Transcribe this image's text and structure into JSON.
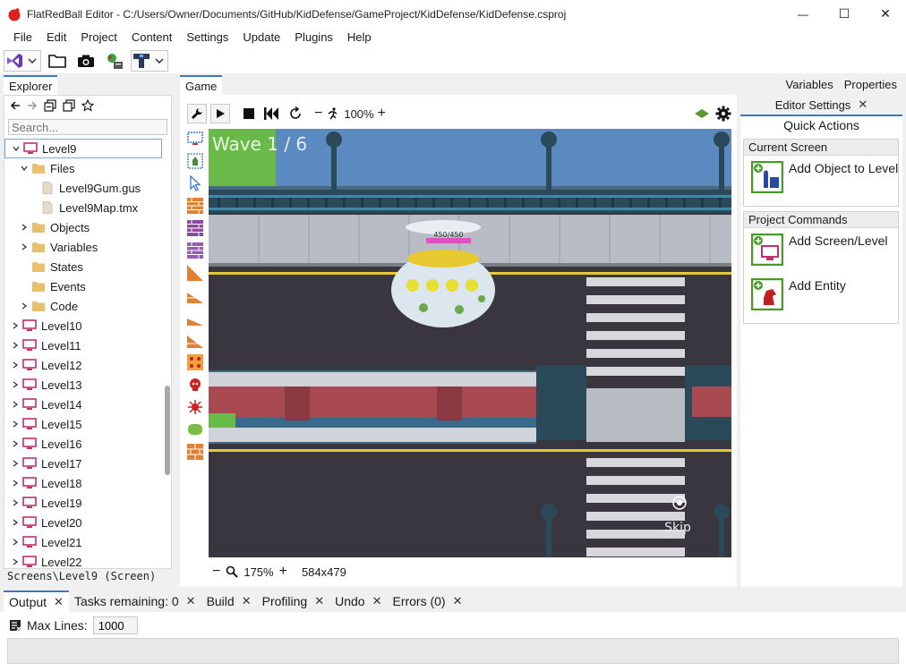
{
  "window": {
    "title": "FlatRedBall Editor - C:/Users/Owner/Documents/GitHub/KidDefense/GameProject/KidDefense/KidDefense.csproj",
    "minimize_glyph": "—",
    "maximize_glyph": "☐",
    "close_glyph": "✕"
  },
  "menu": [
    "File",
    "Edit",
    "Project",
    "Content",
    "Settings",
    "Update",
    "Plugins",
    "Help"
  ],
  "explorer": {
    "tab": "Explorer",
    "search_placeholder": "Search...",
    "status": "Screens\\Level9 (Screen)",
    "tree": [
      {
        "label": "Level9",
        "icon": "screen-icon",
        "depth": 1,
        "expanded": true,
        "selected": true
      },
      {
        "label": "Files",
        "icon": "folder-icon",
        "depth": 2,
        "expanded": true
      },
      {
        "label": "Level9Gum.gus",
        "icon": "file-icon",
        "depth": 3
      },
      {
        "label": "Level9Map.tmx",
        "icon": "file-icon",
        "depth": 3
      },
      {
        "label": "Objects",
        "icon": "folder-icon",
        "depth": 2,
        "expanded": false
      },
      {
        "label": "Variables",
        "icon": "folder-icon",
        "depth": 2,
        "expanded": false
      },
      {
        "label": "States",
        "icon": "folder-icon",
        "depth": 2
      },
      {
        "label": "Events",
        "icon": "folder-icon",
        "depth": 2
      },
      {
        "label": "Code",
        "icon": "folder-icon",
        "depth": 2,
        "expanded": false
      },
      {
        "label": "Level10",
        "icon": "screen-icon",
        "depth": 1,
        "expanded": false
      },
      {
        "label": "Level11",
        "icon": "screen-icon",
        "depth": 1,
        "expanded": false
      },
      {
        "label": "Level12",
        "icon": "screen-icon",
        "depth": 1,
        "expanded": false
      },
      {
        "label": "Level13",
        "icon": "screen-icon",
        "depth": 1,
        "expanded": false
      },
      {
        "label": "Level14",
        "icon": "screen-icon",
        "depth": 1,
        "expanded": false
      },
      {
        "label": "Level15",
        "icon": "screen-icon",
        "depth": 1,
        "expanded": false
      },
      {
        "label": "Level16",
        "icon": "screen-icon",
        "depth": 1,
        "expanded": false
      },
      {
        "label": "Level17",
        "icon": "screen-icon",
        "depth": 1,
        "expanded": false
      },
      {
        "label": "Level18",
        "icon": "screen-icon",
        "depth": 1,
        "expanded": false
      },
      {
        "label": "Level19",
        "icon": "screen-icon",
        "depth": 1,
        "expanded": false
      },
      {
        "label": "Level20",
        "icon": "screen-icon",
        "depth": 1,
        "expanded": false
      },
      {
        "label": "Level21",
        "icon": "screen-icon",
        "depth": 1,
        "expanded": false
      },
      {
        "label": "Level22",
        "icon": "screen-icon",
        "depth": 1,
        "expanded": false
      }
    ]
  },
  "game": {
    "tab": "Game",
    "zoom_top": "100%",
    "zoom_bottom": "175%",
    "resolution": "584x479",
    "wave_text": "Wave 1 / 6",
    "health_text": "450/450",
    "skip_text": "Skip"
  },
  "right_panel": {
    "tabs_top": [
      "Variables",
      "Properties"
    ],
    "tab_editor_settings": "Editor Settings",
    "tab_quick_actions": "Quick Actions",
    "groups": [
      {
        "header": "Current Screen",
        "actions": [
          {
            "label": "Add Object to Level9",
            "icon": "add-object-icon"
          }
        ]
      },
      {
        "header": "Project Commands",
        "actions": [
          {
            "label": "Add Screen/Level",
            "icon": "add-screen-icon"
          },
          {
            "label": "Add Entity",
            "icon": "add-entity-icon"
          }
        ]
      }
    ]
  },
  "bottom": {
    "tabs": [
      "Output",
      "Tasks remaining: 0",
      "Build",
      "Profiling",
      "Undo",
      "Errors (0)"
    ],
    "max_lines_label": "Max Lines:",
    "max_lines_value": "1000"
  },
  "colors": {
    "accent": "#3c78c8",
    "screen_icon": "#c0306a",
    "folder_icon": "#e8c070",
    "quick_action_green": "#4a9a2a"
  }
}
